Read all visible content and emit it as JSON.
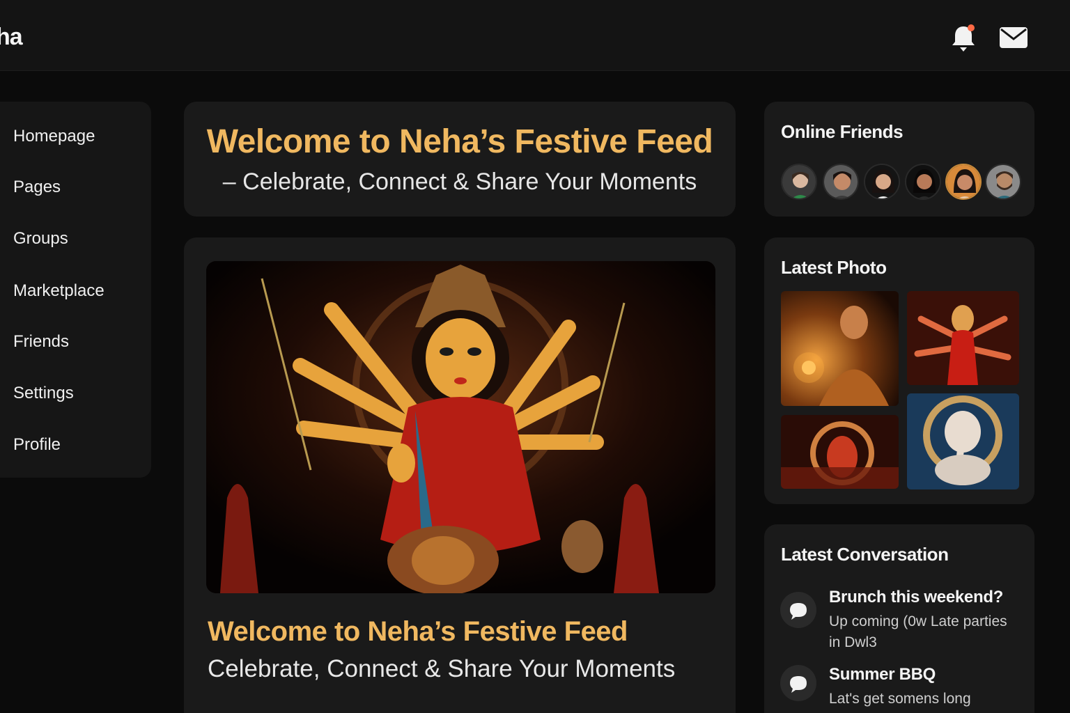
{
  "header": {
    "brand": "ha",
    "icons": {
      "notification": "bell-icon",
      "messages": "mail-icon"
    },
    "notification_dot_color": "#ff6a45"
  },
  "sidebar": {
    "items": [
      {
        "label": "Homepage"
      },
      {
        "label": "Pages"
      },
      {
        "label": "Groups"
      },
      {
        "label": "Marketplace"
      },
      {
        "label": "Friends"
      },
      {
        "label": "Settings"
      },
      {
        "label": "Profile"
      }
    ]
  },
  "welcome": {
    "title": "Welcome to Neha’s Festive Feed",
    "subtitle": "– Celebrate, Connect & Share Your Moments"
  },
  "post": {
    "image_subject": "Goddess Durga idol",
    "title": "Welcome to Neha’s Festive Feed",
    "subtitle": "Celebrate, Connect & Share Your Moments"
  },
  "online_friends": {
    "heading": "Online Friends",
    "count": 6
  },
  "latest_photo": {
    "heading": "Latest Photo",
    "photos": [
      {
        "subject": "man with sparkler"
      },
      {
        "subject": "Durga idol"
      },
      {
        "subject": "pandal lights"
      },
      {
        "subject": "Ganesha idol"
      }
    ]
  },
  "latest_conversation": {
    "heading": "Latest Conversation",
    "items": [
      {
        "title": "Brunch this weekend?",
        "text": "Up coming (0w  Late parties in Dwl3"
      },
      {
        "title": "Summer BBQ",
        "text": "Lat's get somens long"
      }
    ]
  },
  "colors": {
    "accent": "#f0b860",
    "background": "#0b0b0b",
    "card": "#1a1a1a"
  }
}
